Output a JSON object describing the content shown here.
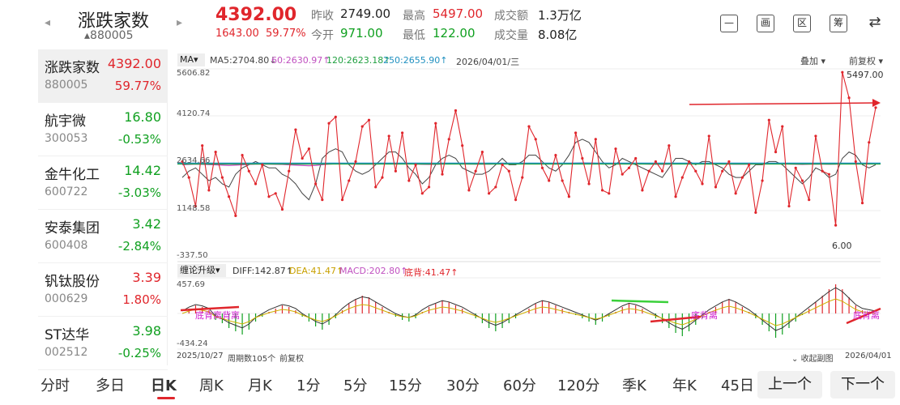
{
  "header": {
    "title": "涨跌家数",
    "code": "880005",
    "price": "4392.00",
    "change_abs": "1643.00",
    "change_pct": "59.77%",
    "stats": {
      "prev_close_label": "昨收",
      "prev_close": "2749.00",
      "open_label": "今开",
      "open": "971.00",
      "high_label": "最高",
      "high": "5497.00",
      "low_label": "最低",
      "low": "122.00",
      "amount_label": "成交额",
      "amount": "1.3万亿",
      "volume_label": "成交量",
      "volume": "8.08亿"
    },
    "tools": [
      "—",
      "画",
      "区",
      "筹",
      "⇄"
    ]
  },
  "sidebar": {
    "items": [
      {
        "name": "涨跌家数",
        "code": "880005",
        "price": "4392.00",
        "pct": "59.77%",
        "dir": "up"
      },
      {
        "name": "航宇微",
        "code": "300053",
        "price": "16.80",
        "pct": "-0.53%",
        "dir": "down"
      },
      {
        "name": "金牛化工",
        "code": "600722",
        "price": "14.42",
        "pct": "-3.03%",
        "dir": "down"
      },
      {
        "name": "安泰集团",
        "code": "600408",
        "price": "3.42",
        "pct": "-2.84%",
        "dir": "down"
      },
      {
        "name": "钒钛股份",
        "code": "000629",
        "price": "3.39",
        "pct": "1.80%",
        "dir": "up"
      },
      {
        "name": "ST达华",
        "code": "002512",
        "price": "3.98",
        "pct": "-0.25%",
        "dir": "down"
      }
    ]
  },
  "chart": {
    "ma_select": "MA",
    "ma5": "MA5:2704.80↓",
    "ma60": "60:2630.97↑",
    "ma120": "120:2623.18↑",
    "ma250": "250:2655.90↑",
    "date_label": "2026/04/01/三",
    "overlay": "叠加",
    "adjust": "前复权",
    "y_labels": [
      "5606.82",
      "4120.74",
      "2634.66",
      "1148.58",
      "-337.50"
    ],
    "max_label": "5497.00",
    "min_label": "6.00",
    "indicator_select": "缠论升级",
    "diff": "DIFF:142.87↑",
    "dea": "DEA:41.47↑",
    "macd": "MACD:202.80↑",
    "bottom_div": "底背:41.47↑",
    "ind_y_top": "457.69",
    "ind_y_bottom": "-434.24",
    "annot_left": "底背离背离",
    "annot_mid": "底背离",
    "annot_right": "底背离",
    "start_date": "2025/10/27",
    "period_count": "周期数105个",
    "adjust_mode": "前复权",
    "collapse": "收起副图",
    "end_date": "2026/04/01",
    "colors": {
      "price": "#e0262c",
      "ma5": "#444444",
      "ma60": "#c050c0",
      "ma120": "#20a040",
      "ma250": "#2090c0",
      "diff": "#333333",
      "dea": "#d0b000"
    }
  },
  "chart_data": {
    "type": "line",
    "ylim": [
      -337.5,
      5606.82
    ],
    "series": [
      {
        "name": "MA5",
        "values": [
          2200,
          2400,
          2500,
          2300,
          2100,
          2200,
          2000,
          1900,
          2300,
          2500,
          2600,
          2700,
          2600,
          2500,
          2500,
          2300,
          2200,
          2000,
          1700,
          1500,
          2000,
          2800,
          3000,
          3100,
          3000,
          2600,
          2400,
          2300,
          2400,
          2600,
          2800,
          3000,
          3000,
          2800,
          2500,
          2300,
          2000,
          2200,
          2600,
          2800,
          2900,
          2800,
          2500,
          2400,
          2300,
          2300,
          2400,
          2600,
          2800,
          2600,
          2600,
          2700,
          2900,
          2900,
          2700,
          2500,
          2400,
          2600,
          2900,
          3300,
          3400,
          3300,
          3000,
          2700,
          2500,
          2600,
          2800,
          2700,
          2600,
          2500,
          2400,
          2300,
          2200,
          2500,
          2800,
          2800,
          2700,
          2600,
          2700,
          2700,
          2600,
          2500,
          2300,
          2200,
          2200,
          2400,
          2600,
          2600,
          2700,
          2700,
          2600,
          2400,
          2200,
          2000,
          2200,
          2500,
          2400,
          2200,
          2300,
          2800,
          3000,
          2900,
          2600,
          2500,
          2600
        ]
      },
      {
        "name": "60",
        "values": [
          2600,
          2610,
          2620,
          2615,
          2605,
          2600,
          2590,
          2580,
          2590,
          2600,
          2610,
          2620,
          2625,
          2620,
          2615,
          2610,
          2600,
          2590,
          2580,
          2570,
          2580,
          2600,
          2620,
          2630,
          2635,
          2630,
          2625,
          2620,
          2620,
          2625,
          2630,
          2635,
          2640,
          2638,
          2632,
          2625,
          2615,
          2610,
          2615,
          2625,
          2632,
          2635,
          2630,
          2625,
          2620,
          2620,
          2622,
          2628,
          2635,
          2632,
          2630,
          2632,
          2638,
          2640,
          2636,
          2630,
          2625,
          2630,
          2640,
          2650,
          2655,
          2652,
          2645,
          2638,
          2630,
          2630,
          2635,
          2634,
          2630,
          2626,
          2622,
          2618,
          2614,
          2620,
          2630,
          2632,
          2630,
          2628,
          2630,
          2630,
          2628,
          2625,
          2620,
          2616,
          2616,
          2620,
          2626,
          2627,
          2630,
          2630,
          2628,
          2624,
          2618,
          2612,
          2616,
          2624,
          2622,
          2618,
          2620,
          2632,
          2638,
          2636,
          2632,
          2630,
          2631
        ]
      }
    ]
  },
  "tabs": {
    "items": [
      "分时",
      "多日",
      "日K",
      "周K",
      "月K",
      "1分",
      "5分",
      "15分",
      "30分",
      "60分",
      "120分",
      "季K",
      "年K",
      "45日"
    ],
    "active": "日K",
    "prev": "上一个",
    "next": "下一个"
  }
}
